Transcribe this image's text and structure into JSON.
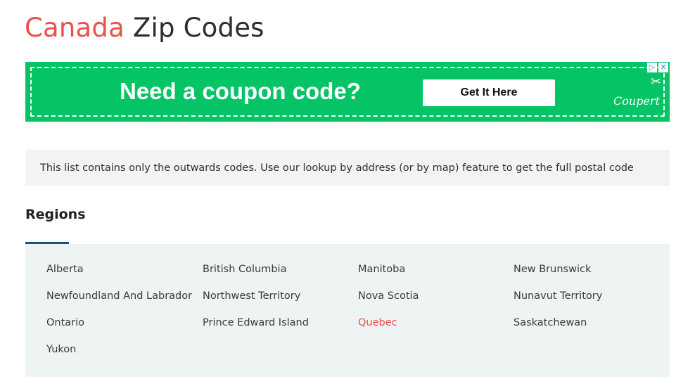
{
  "header": {
    "title_accent": "Canada",
    "title_rest": "Zip Codes"
  },
  "ad": {
    "headline": "Need a coupon code?",
    "cta_label": "Get It Here",
    "brand": "Coupert",
    "adchoices": [
      "▷",
      "✕"
    ],
    "scissors_icon": "✂",
    "background_color": "#05c466"
  },
  "notice": {
    "text": "This list contains only the outwards codes. Use our lookup by address (or by map) feature to get the full postal code"
  },
  "regions": {
    "heading": "Regions",
    "items": [
      {
        "label": "Alberta"
      },
      {
        "label": "British Columbia"
      },
      {
        "label": "Manitoba"
      },
      {
        "label": "New Brunswick"
      },
      {
        "label": "Newfoundland And Labrador"
      },
      {
        "label": "Northwest Territory"
      },
      {
        "label": "Nova Scotia"
      },
      {
        "label": "Nunavut Territory"
      },
      {
        "label": "Ontario"
      },
      {
        "label": "Prince Edward Island"
      },
      {
        "label": "Quebec",
        "active": true
      },
      {
        "label": "Saskatchewan"
      },
      {
        "label": "Yukon"
      }
    ]
  },
  "colors": {
    "accent": "#e8524a",
    "underline": "#1e4f7e",
    "panel": "#eef3f3"
  }
}
